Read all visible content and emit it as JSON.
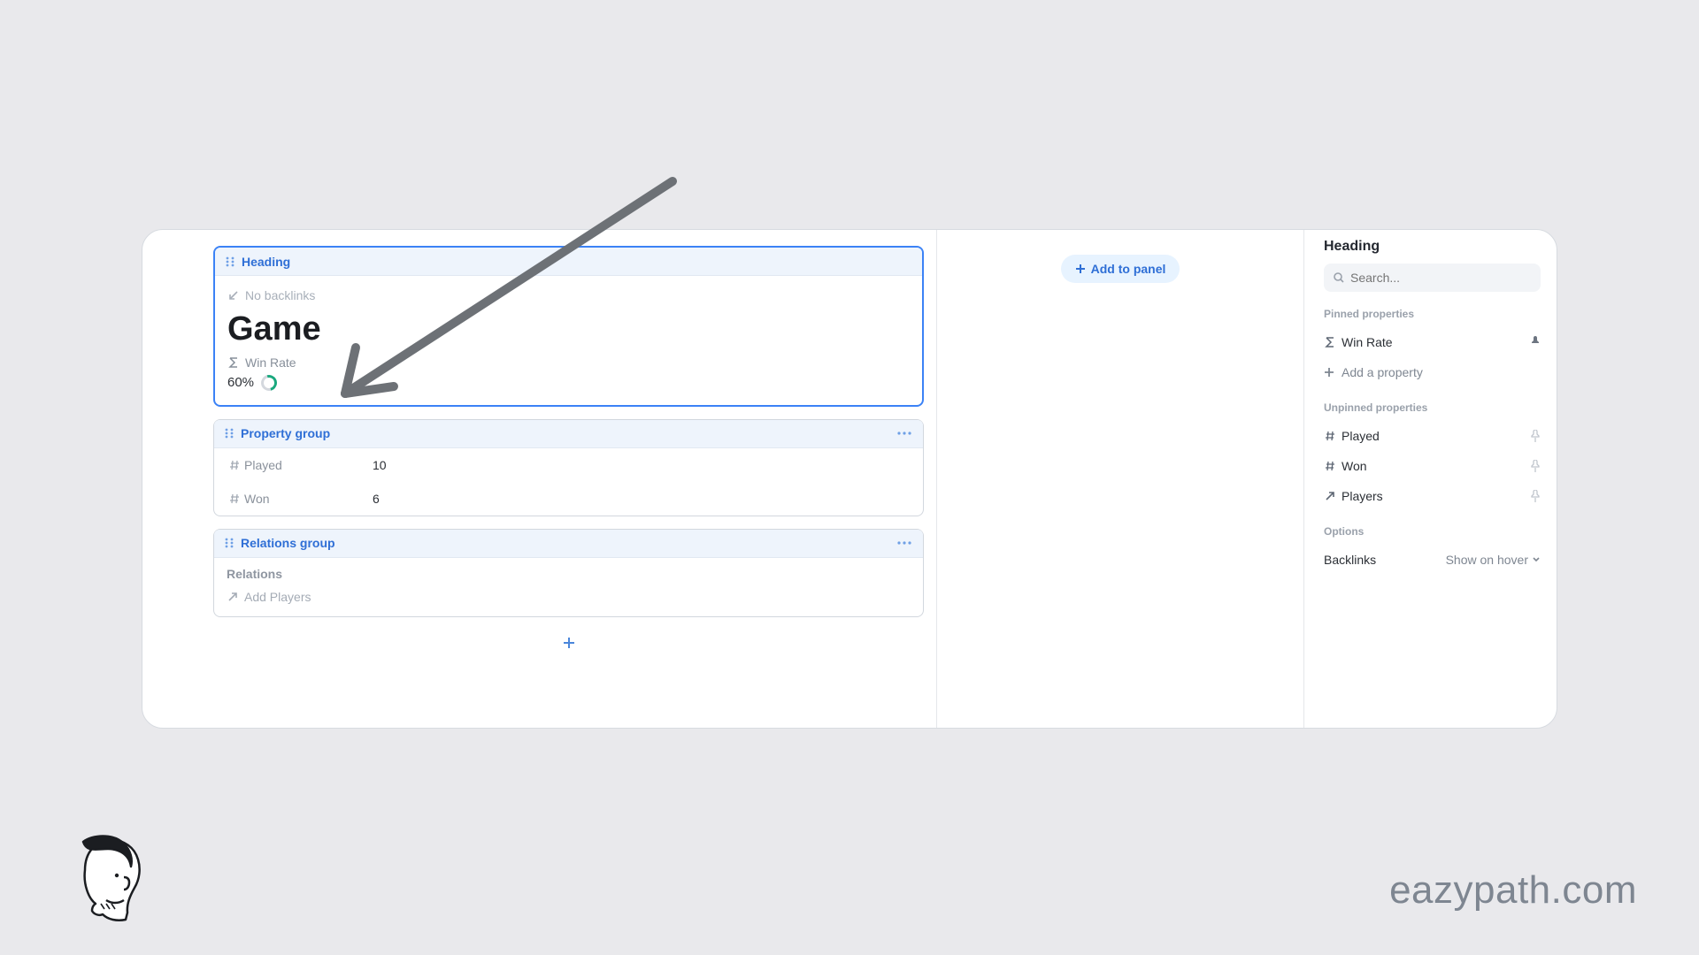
{
  "editor": {
    "heading_block": {
      "label": "Heading",
      "backlinks_text": "No backlinks",
      "title": "Game",
      "pinned": {
        "label": "Win Rate",
        "value": "60%"
      }
    },
    "property_group": {
      "label": "Property group",
      "rows": [
        {
          "label": "Played",
          "value": "10"
        },
        {
          "label": "Won",
          "value": "6"
        }
      ]
    },
    "relations_group": {
      "label": "Relations group",
      "subhead": "Relations",
      "add_players": "Add Players"
    }
  },
  "middle": {
    "add_to_panel": "Add to panel"
  },
  "sidebar": {
    "title": "Heading",
    "search_placeholder": "Search...",
    "pinned_label": "Pinned properties",
    "pinned": [
      {
        "name": "Win Rate"
      }
    ],
    "add_property": "Add a property",
    "unpinned_label": "Unpinned properties",
    "unpinned": [
      {
        "name": "Played"
      },
      {
        "name": "Won"
      },
      {
        "name": "Players"
      }
    ],
    "options_label": "Options",
    "backlinks_label": "Backlinks",
    "backlinks_value": "Show on hover"
  },
  "watermark": "eazypath.com"
}
